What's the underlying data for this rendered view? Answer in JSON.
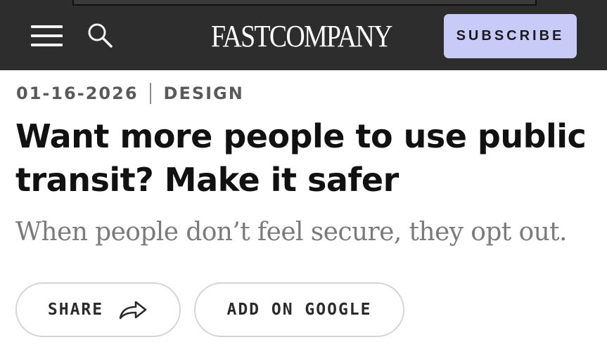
{
  "header": {
    "logo_text": "FASTCOMPANY",
    "subscribe_label": "SUBSCRIBE",
    "icons": [
      "menu-icon",
      "search-icon"
    ],
    "background_color": "#2d2d2d",
    "subscribe_color": "#c8cbf8"
  },
  "article": {
    "date": "01-16-2026",
    "category": "DESIGN",
    "headline": "Want more people to use public transit? Make it safer",
    "dek": "When people don’t feel secure, they opt out."
  },
  "actions": {
    "share_label": "SHARE",
    "share_icon": "share-arrow-icon",
    "google_label": "ADD ON GOOGLE"
  }
}
